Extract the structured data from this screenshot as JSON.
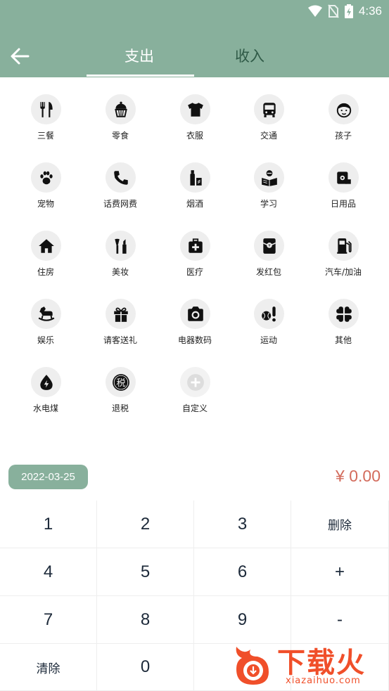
{
  "status_bar": {
    "time": "4:36"
  },
  "header": {
    "tabs": [
      {
        "label": "支出",
        "active": true
      },
      {
        "label": "收入",
        "active": false
      }
    ]
  },
  "categories": [
    {
      "label": "三餐",
      "icon": "utensils-icon"
    },
    {
      "label": "零食",
      "icon": "cupcake-icon"
    },
    {
      "label": "衣服",
      "icon": "tshirt-icon"
    },
    {
      "label": "交通",
      "icon": "bus-icon"
    },
    {
      "label": "孩子",
      "icon": "child-face-icon"
    },
    {
      "label": "宠物",
      "icon": "paw-icon"
    },
    {
      "label": "话费网费",
      "icon": "phone-icon"
    },
    {
      "label": "烟酒",
      "icon": "bottle-icon"
    },
    {
      "label": "学习",
      "icon": "reading-icon"
    },
    {
      "label": "日用品",
      "icon": "tissue-roll-icon"
    },
    {
      "label": "住房",
      "icon": "house-icon"
    },
    {
      "label": "美妆",
      "icon": "makeup-icon"
    },
    {
      "label": "医疗",
      "icon": "medical-kit-icon"
    },
    {
      "label": "发红包",
      "icon": "red-envelope-icon"
    },
    {
      "label": "汽车/加油",
      "icon": "gas-pump-icon"
    },
    {
      "label": "娱乐",
      "icon": "rocking-horse-icon"
    },
    {
      "label": "请客送礼",
      "icon": "gift-icon"
    },
    {
      "label": "电器数码",
      "icon": "camera-icon"
    },
    {
      "label": "运动",
      "icon": "ball-icon"
    },
    {
      "label": "其他",
      "icon": "clover-icon"
    },
    {
      "label": "水电煤",
      "icon": "water-drop-icon"
    },
    {
      "label": "退税",
      "icon": "tax-icon",
      "icon_text": "税"
    },
    {
      "label": "自定义",
      "icon": "add-icon"
    }
  ],
  "date": "2022-03-25",
  "amount": "¥ 0.00",
  "keypad": [
    [
      "1",
      "2",
      "3",
      "删除"
    ],
    [
      "4",
      "5",
      "6",
      "+"
    ],
    [
      "7",
      "8",
      "9",
      "-"
    ],
    [
      "清除",
      "0",
      "",
      ""
    ]
  ],
  "watermark": {
    "title": "下载火",
    "url": "xiazaihuo.com"
  },
  "colors": {
    "header": "#88b09c",
    "amount": "#d36b5c",
    "watermark": "#f04f2a"
  }
}
